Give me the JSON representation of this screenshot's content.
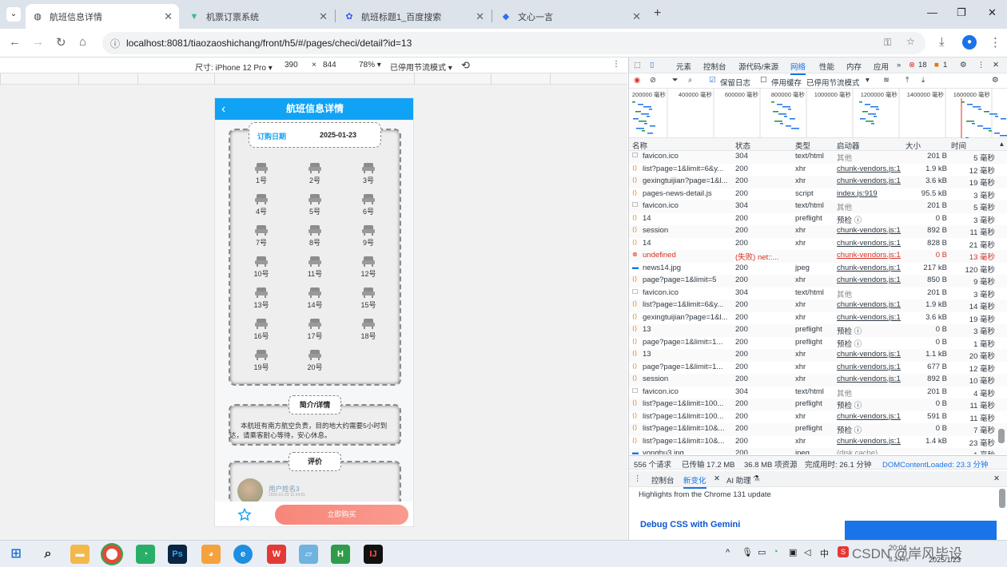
{
  "browser": {
    "tabs": [
      {
        "title": "航班信息详情",
        "active": true
      },
      {
        "title": "机票订票系统",
        "active": false
      },
      {
        "title": "航班标题1_百度搜索",
        "active": false
      },
      {
        "title": "文心一言",
        "active": false
      }
    ],
    "url": "localhost:8081/tiaozaoshichang/front/h5/#/pages/checi/detail?id=13"
  },
  "device_toolbar": {
    "size_label": "尺寸: iPhone 12 Pro ▾",
    "width": "390",
    "times": "×",
    "height": "844",
    "zoom": "78% ▾",
    "throttle": "已停用节流模式 ▾"
  },
  "app": {
    "header_title": "航班信息详情",
    "back_icon": "‹",
    "order_date_label": "订购日期",
    "order_date_value": "2025-01-23",
    "seats": [
      "1号",
      "2号",
      "3号",
      "4号",
      "5号",
      "6号",
      "7号",
      "8号",
      "9号",
      "10号",
      "11号",
      "12号",
      "13号",
      "14号",
      "15号",
      "16号",
      "17号",
      "18号",
      "19号",
      "20号"
    ],
    "intro_title": "简介/详情",
    "intro_text": "本航班有南方航空负责，目的地大约需要5小时到达，请乘客耐心等待，安心休息。",
    "review_title": "评价",
    "review_user": "用户姓名3",
    "review_time": "2025-01-23 11:34:01",
    "buy_label": "立即购买",
    "accent_color": "#0fa2f5"
  },
  "devtools": {
    "tabs": [
      "元素",
      "控制台",
      "源代码/来源",
      "网络",
      "性能",
      "内存",
      "应用",
      "»"
    ],
    "active_tab": "网络",
    "error_count": "18",
    "warn_count": "1",
    "filter_preserve_log": "保留日志",
    "filter_disable_cache": "停用缓存",
    "filter_throttle": "已停用节流模式",
    "timeline_ticks": [
      "200000 毫秒",
      "400000 毫秒",
      "600000 毫秒",
      "800000 毫秒",
      "1000000 毫秒",
      "1200000 毫秒",
      "1400000 毫秒",
      "1600000 毫秒"
    ],
    "columns": [
      "名称",
      "状态",
      "类型",
      "启动器",
      "大小",
      "时间"
    ],
    "rows": [
      {
        "name": "favicon.ico",
        "status": "304",
        "type": "text/html",
        "initiator": "其他",
        "size": "201 B",
        "time": "5 毫秒",
        "icon": "doc"
      },
      {
        "name": "list?page=1&limit=6&y...",
        "status": "200",
        "type": "xhr",
        "initiator": "chunk-vendors.js:14",
        "size": "1.9 kB",
        "time": "12 毫秒",
        "icon": "xhr"
      },
      {
        "name": "gexingtuijian?page=1&l...",
        "status": "200",
        "type": "xhr",
        "initiator": "chunk-vendors.js:14",
        "size": "3.6 kB",
        "time": "19 毫秒",
        "icon": "xhr"
      },
      {
        "name": "pages-news-detail.js",
        "status": "200",
        "type": "script",
        "initiator": "index.js:919",
        "size": "95.5 kB",
        "time": "3 毫秒",
        "icon": "js"
      },
      {
        "name": "favicon.ico",
        "status": "304",
        "type": "text/html",
        "initiator": "其他",
        "size": "201 B",
        "time": "5 毫秒",
        "icon": "doc"
      },
      {
        "name": "14",
        "status": "200",
        "type": "preflight",
        "initiator": "预检 ⓘ",
        "size": "0 B",
        "time": "3 毫秒",
        "icon": "xhr"
      },
      {
        "name": "session",
        "status": "200",
        "type": "xhr",
        "initiator": "chunk-vendors.js:14",
        "size": "892 B",
        "time": "11 毫秒",
        "icon": "xhr"
      },
      {
        "name": "14",
        "status": "200",
        "type": "xhr",
        "initiator": "chunk-vendors.js:14",
        "size": "828 B",
        "time": "21 毫秒",
        "icon": "xhr"
      },
      {
        "name": "undefined",
        "status": "(失败)  net::...",
        "type": "",
        "initiator": "chunk-vendors.js:14",
        "size": "0 B",
        "time": "13 毫秒",
        "icon": "err"
      },
      {
        "name": "news14.jpg",
        "status": "200",
        "type": "jpeg",
        "initiator": "chunk-vendors.js:14",
        "size": "217 kB",
        "time": "120 毫秒",
        "icon": "img"
      },
      {
        "name": "page?page=1&limit=5",
        "status": "200",
        "type": "xhr",
        "initiator": "chunk-vendors.js:14",
        "size": "850 B",
        "time": "9 毫秒",
        "icon": "xhr"
      },
      {
        "name": "favicon.ico",
        "status": "304",
        "type": "text/html",
        "initiator": "其他",
        "size": "201 B",
        "time": "3 毫秒",
        "icon": "doc"
      },
      {
        "name": "list?page=1&limit=6&y...",
        "status": "200",
        "type": "xhr",
        "initiator": "chunk-vendors.js:14",
        "size": "1.9 kB",
        "time": "14 毫秒",
        "icon": "xhr"
      },
      {
        "name": "gexingtuijian?page=1&l...",
        "status": "200",
        "type": "xhr",
        "initiator": "chunk-vendors.js:14",
        "size": "3.6 kB",
        "time": "19 毫秒",
        "icon": "xhr"
      },
      {
        "name": "13",
        "status": "200",
        "type": "preflight",
        "initiator": "预检 ⓘ",
        "size": "0 B",
        "time": "3 毫秒",
        "icon": "xhr"
      },
      {
        "name": "page?page=1&limit=1...",
        "status": "200",
        "type": "preflight",
        "initiator": "预检 ⓘ",
        "size": "0 B",
        "time": "1 毫秒",
        "icon": "xhr"
      },
      {
        "name": "13",
        "status": "200",
        "type": "xhr",
        "initiator": "chunk-vendors.js:14",
        "size": "1.1 kB",
        "time": "20 毫秒",
        "icon": "xhr"
      },
      {
        "name": "page?page=1&limit=1...",
        "status": "200",
        "type": "xhr",
        "initiator": "chunk-vendors.js:14",
        "size": "677 B",
        "time": "12 毫秒",
        "icon": "xhr"
      },
      {
        "name": "session",
        "status": "200",
        "type": "xhr",
        "initiator": "chunk-vendors.js:14",
        "size": "892 B",
        "time": "10 毫秒",
        "icon": "xhr"
      },
      {
        "name": "favicon.ico",
        "status": "304",
        "type": "text/html",
        "initiator": "其他",
        "size": "201 B",
        "time": "4 毫秒",
        "icon": "doc"
      },
      {
        "name": "list?page=1&limit=100...",
        "status": "200",
        "type": "preflight",
        "initiator": "预检 ⓘ",
        "size": "0 B",
        "time": "11 毫秒",
        "icon": "xhr"
      },
      {
        "name": "list?page=1&limit=100...",
        "status": "200",
        "type": "xhr",
        "initiator": "chunk-vendors.js:14",
        "size": "591 B",
        "time": "11 毫秒",
        "icon": "xhr"
      },
      {
        "name": "list?page=1&limit=10&...",
        "status": "200",
        "type": "preflight",
        "initiator": "预检 ⓘ",
        "size": "0 B",
        "time": "7 毫秒",
        "icon": "xhr"
      },
      {
        "name": "list?page=1&limit=10&...",
        "status": "200",
        "type": "xhr",
        "initiator": "chunk-vendors.js:14",
        "size": "1.4 kB",
        "time": "23 毫秒",
        "icon": "xhr"
      },
      {
        "name": "yonghu3.jpg",
        "status": "200",
        "type": "jpeg",
        "initiator": "(disk cache)",
        "size": "",
        "time": "1 毫秒",
        "icon": "img"
      }
    ],
    "summary": {
      "requests": "556 个请求",
      "transferred": "已传输 17.2 MB",
      "resources": "36.8 MB 项资源",
      "finish": "完成用时: 26.1 分钟",
      "dcl": "DOMContentLoaded: 23.3 分钟"
    },
    "drawer_tabs": [
      "控制台",
      "新变化",
      "AI 助理"
    ],
    "drawer_active": "新变化",
    "drawer_headline": "Highlights from the Chrome 131 update",
    "drawer_link": "Debug CSS with Gemini"
  },
  "taskbar": {
    "ime": "中",
    "clock_time": "20:04",
    "clock_date": "2025/1/23",
    "net_speed": "8.2 K/s",
    "watermark": "CSDN @岸风毕设"
  }
}
